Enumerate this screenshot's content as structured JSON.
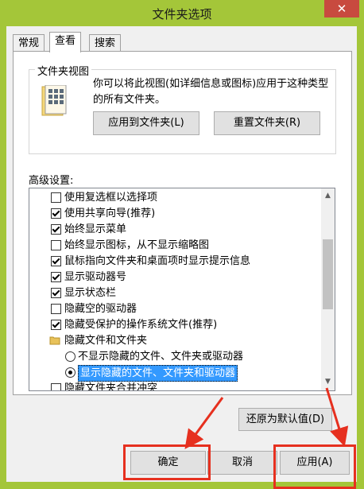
{
  "window": {
    "title": "文件夹选项",
    "close_glyph": "✕"
  },
  "tabs": [
    "常规",
    "查看",
    "搜索"
  ],
  "folder_views": {
    "legend": "文件夹视图",
    "description": "你可以将此视图(如详细信息或图标)应用于这种类型的所有文件夹。",
    "apply_button": "应用到文件夹(L)",
    "reset_button": "重置文件夹(R)"
  },
  "advanced": {
    "label": "高级设置:",
    "items": [
      {
        "type": "checkbox",
        "checked": false,
        "label": "使用复选框以选择项"
      },
      {
        "type": "checkbox",
        "checked": true,
        "label": "使用共享向导(推荐)"
      },
      {
        "type": "checkbox",
        "checked": true,
        "label": "始终显示菜单"
      },
      {
        "type": "checkbox",
        "checked": false,
        "label": "始终显示图标，从不显示缩略图"
      },
      {
        "type": "checkbox",
        "checked": true,
        "label": "鼠标指向文件夹和桌面项时显示提示信息"
      },
      {
        "type": "checkbox",
        "checked": true,
        "label": "显示驱动器号"
      },
      {
        "type": "checkbox",
        "checked": true,
        "label": "显示状态栏"
      },
      {
        "type": "checkbox",
        "checked": false,
        "label": "隐藏空的驱动器"
      },
      {
        "type": "checkbox",
        "checked": true,
        "label": "隐藏受保护的操作系统文件(推荐)"
      },
      {
        "type": "folder",
        "label": "隐藏文件和文件夹"
      },
      {
        "type": "radio",
        "checked": false,
        "label": "不显示隐藏的文件、文件夹或驱动器"
      },
      {
        "type": "radio",
        "checked": true,
        "label": "显示隐藏的文件、文件夹和驱动器"
      },
      {
        "type": "checkbox",
        "checked": false,
        "label": "隐藏文件夹合并冲突"
      }
    ],
    "restore_button": "还原为默认值(D)"
  },
  "footer": {
    "ok": "确定",
    "cancel": "取消",
    "apply": "应用(A)"
  },
  "colors": {
    "title_bar": "#a4c639",
    "close": "#c84a3f",
    "highlight": "#3399ff",
    "annotation": "#e6301f"
  }
}
